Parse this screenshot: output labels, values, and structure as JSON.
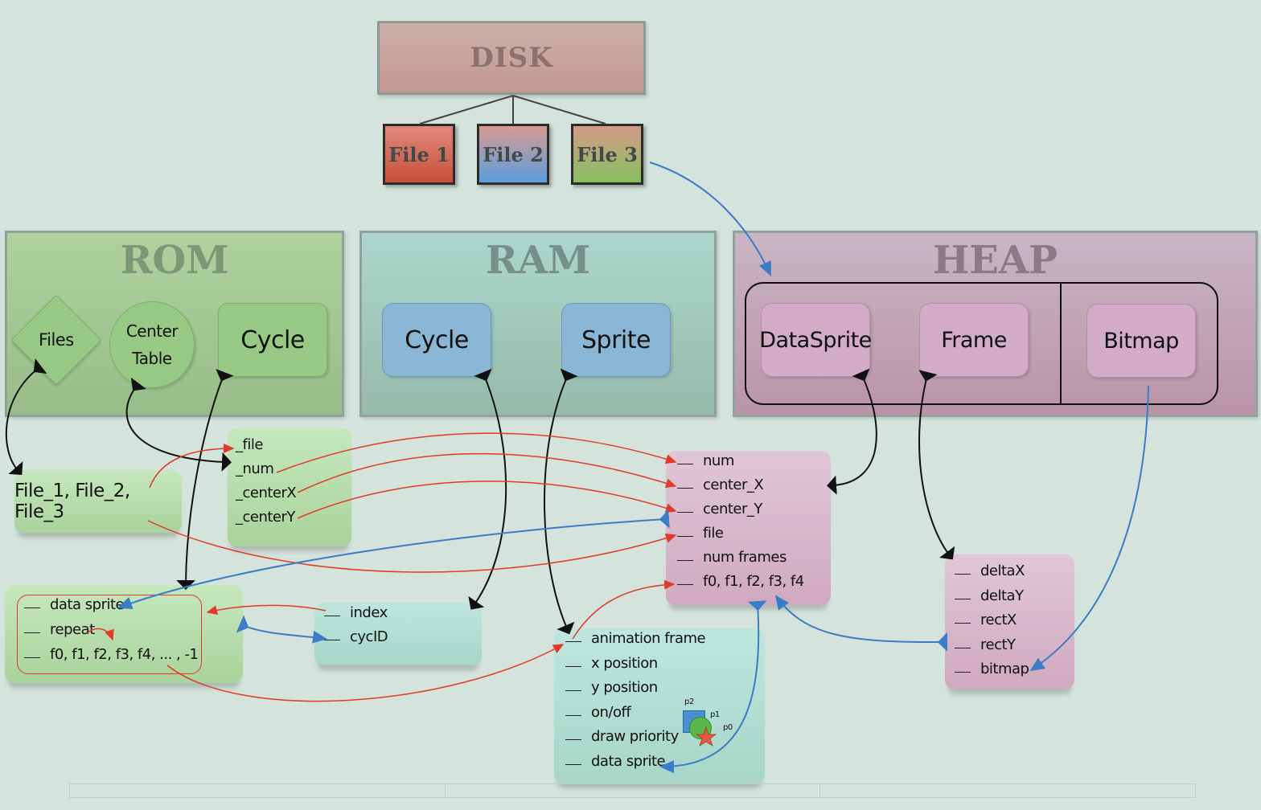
{
  "disk": {
    "title": "DISK",
    "files": [
      {
        "label": "File 1",
        "color": "#c8503c"
      },
      {
        "label": "File 2",
        "color": "#5a9ede"
      },
      {
        "label": "File 3",
        "color": "#86c05e"
      }
    ]
  },
  "regions": {
    "rom": {
      "title": "ROM",
      "nodes": {
        "files": "Files",
        "center_table_line1": "Center",
        "center_table_line2": "Table",
        "cycle": "Cycle"
      }
    },
    "ram": {
      "title": "RAM",
      "nodes": {
        "cycle": "Cycle",
        "sprite": "Sprite"
      }
    },
    "heap": {
      "title": "HEAP",
      "nodes": {
        "datasprite": "DataSprite",
        "frame": "Frame",
        "bitmap": "Bitmap"
      }
    }
  },
  "cards": {
    "files_list": {
      "text": "File_1, File_2, File_3"
    },
    "center_table_fields": [
      "_file",
      "_num",
      "_centerX",
      "_centerY"
    ],
    "rom_cycle_fields": [
      "data sprite",
      "repeat",
      "f0, f1, f2, f3, f4, ... , -1"
    ],
    "ram_cycle_fields": [
      "index",
      "cycID"
    ],
    "datasprite_fields": [
      "num",
      "center_X",
      "center_Y",
      "file",
      "num frames",
      "f0, f1, f2, f3, f4"
    ],
    "sprite_fields": [
      "animation frame",
      "x position",
      "y position",
      "on/off",
      "draw priority",
      "data sprite"
    ],
    "frame_fields": [
      "deltaX",
      "deltaY",
      "rectX",
      "rectY",
      "bitmap"
    ]
  },
  "priority_icon": {
    "labels": [
      "p2",
      "p1",
      "p0"
    ]
  },
  "colors": {
    "reference_arrow": "#e03a2a",
    "pointer_arrow": "#3a7cc8",
    "ownership_arrow": "#111111",
    "background": "#d4e3dc"
  }
}
